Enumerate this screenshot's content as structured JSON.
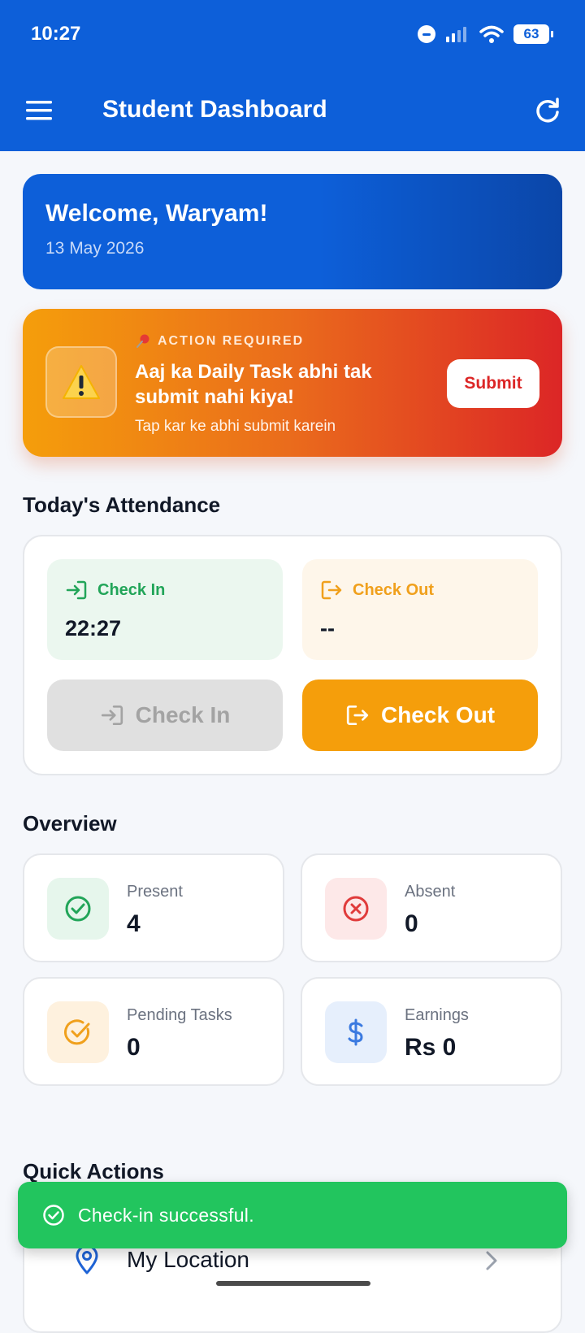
{
  "status_bar": {
    "time": "10:27",
    "battery": "63"
  },
  "app_bar": {
    "title": "Student Dashboard"
  },
  "welcome": {
    "greeting": "Welcome, Waryam!",
    "date": "13 May 2026"
  },
  "action_alert": {
    "tag": "ACTION REQUIRED",
    "title": "Aaj ka Daily Task abhi tak submit nahi kiya!",
    "subtitle": "Tap kar ke abhi submit karein",
    "button_label": "Submit"
  },
  "attendance": {
    "section_title": "Today's Attendance",
    "check_in_label": "Check In",
    "check_in_time": "22:27",
    "check_out_label": "Check Out",
    "check_out_time": "--",
    "check_in_button": "Check In",
    "check_out_button": "Check Out"
  },
  "overview": {
    "section_title": "Overview",
    "stats": [
      {
        "label": "Present",
        "value": "4",
        "icon": "check-circle-icon",
        "color": "#22a559"
      },
      {
        "label": "Absent",
        "value": "0",
        "icon": "x-circle-icon",
        "color": "#e03b3b"
      },
      {
        "label": "Pending Tasks",
        "value": "0",
        "icon": "task-check-icon",
        "color": "#f0a01c"
      },
      {
        "label": "Earnings",
        "value": "Rs 0",
        "icon": "dollar-icon",
        "color": "#3b7ae0"
      }
    ]
  },
  "quick_actions": {
    "section_title": "Quick Actions",
    "items": [
      {
        "label": "My Location",
        "icon": "location-pin-icon"
      }
    ]
  },
  "toast": {
    "message": "Check-in successful."
  },
  "colors": {
    "primary": "#0d5fd9",
    "success": "#22c55e",
    "warning": "#f59e0b",
    "danger": "#dc2626"
  }
}
